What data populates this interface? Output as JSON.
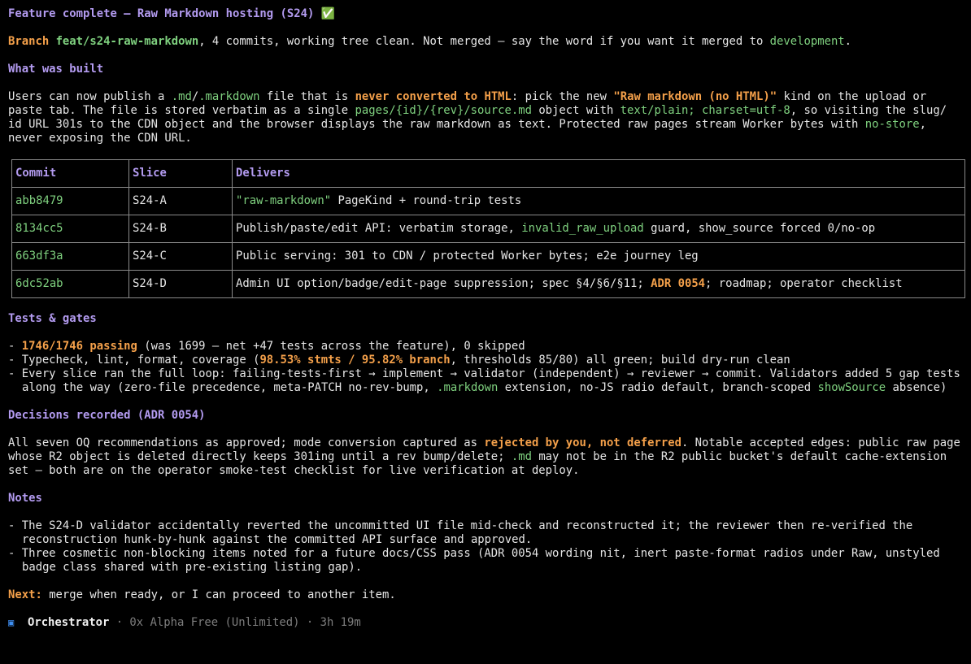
{
  "title": "Feature complete — Raw Markdown hosting (S24) ✅",
  "branch_line": {
    "label": "Branch",
    "name": "feat/s24-raw-markdown",
    "middle": ", 4 commits, working tree clean. Not merged — say the word if you want it merged to ",
    "target": "development",
    "end": "."
  },
  "built": {
    "heading": "What was built",
    "p1": "Users can now publish a ",
    "ext1": ".md",
    "slash": "/",
    "ext2": ".markdown",
    "p2": " file that is ",
    "never": "never converted to HTML",
    "p3": ": pick the new ",
    "kind": "\"Raw markdown (no HTML)\"",
    "p4": " kind on the upload or paste tab. The file is stored verbatim as a single ",
    "path": "pages/{id}/{rev}/source.md",
    "p5": " object with ",
    "ctype": "text/plain; charset=utf-8",
    "p6": ", so visiting the slug/ id URL 301s to the CDN object and the browser displays the raw markdown as text. Protected raw pages stream Worker bytes with ",
    "nostore": "no-store",
    "p7": ", never exposing the CDN URL."
  },
  "table": {
    "headers": [
      "Commit",
      "Slice",
      "Delivers"
    ],
    "rows": [
      {
        "commit": "abb8479",
        "slice": "S24-A",
        "d1": "",
        "dg": "\"raw-markdown\"",
        "d2": " PageKind + round-trip tests",
        "db": "",
        "d3": ""
      },
      {
        "commit": "8134cc5",
        "slice": "S24-B",
        "d1": "Publish/paste/edit API: verbatim storage, ",
        "dg": "invalid_raw_upload",
        "d2": " guard, show_source forced 0/no-op",
        "db": "",
        "d3": ""
      },
      {
        "commit": "663df3a",
        "slice": "S24-C",
        "d1": "Public serving: 301 to CDN / protected Worker bytes; e2e journey leg",
        "dg": "",
        "d2": "",
        "db": "",
        "d3": ""
      },
      {
        "commit": "6dc52ab",
        "slice": "S24-D",
        "d1": "Admin UI option/badge/edit-page suppression; spec §4/§6/§11; ",
        "dg": "",
        "d2": "",
        "db": "ADR 0054",
        "d3": "; roadmap; operator checklist"
      }
    ]
  },
  "tests": {
    "heading": "Tests & gates",
    "i1_bold": "1746/1746 passing",
    "i1_rest": " (was 1699 — net +47 tests across the feature), 0 skipped",
    "i2_a": "Typecheck, lint, format, coverage (",
    "i2_bold": "98.53% stmts / 95.82% branch",
    "i2_b": ", thresholds 85/80) all green; build dry-run clean",
    "i3_a": "Every slice ran the full loop: failing-tests-first → implement → validator (independent) → reviewer → commit. Validators added 5 gap tests along the way (zero-file precedence, meta-PATCH no-rev-bump, ",
    "i3_g1": ".markdown",
    "i3_b": " extension, no-JS radio default, branch-scoped ",
    "i3_g2": "showSource",
    "i3_c": " absence)"
  },
  "decisions": {
    "heading": "Decisions recorded (ADR 0054)",
    "p1": "All seven OQ recommendations as approved; mode conversion captured as ",
    "bold": "rejected by you, not deferred",
    "p2": ". Notable accepted edges: public raw page whose R2 object is deleted directly keeps 301ing until a rev bump/delete; ",
    "g": ".md",
    "p3": " may not be in the R2 public bucket's default cache-extension set — both are on the operator smoke-test checklist for live verification at deploy."
  },
  "notes": {
    "heading": "Notes",
    "n1": "The S24-D validator accidentally reverted the uncommitted UI file mid-check and reconstructed it; the reviewer then re-verified the reconstruction hunk-by-hunk against the committed API surface and approved.",
    "n2": "Three cosmetic non-blocking items noted for a future docs/CSS pass (ADR 0054 wording nit, inert paste-format radios under Raw, unstyled badge class shared with pre-existing listing gap)."
  },
  "next": {
    "label": "Next:",
    "text": " merge when ready, or I can proceed to another item."
  },
  "status": {
    "icon": "square-icon",
    "agent": "Orchestrator",
    "sep1": " · ",
    "model": "0x Alpha Free (Unlimited)",
    "sep2": " · ",
    "elapsed": "3h 19m"
  },
  "colors": {
    "heading": "#b39bf0",
    "bold_accent": "#f4a04a",
    "code": "#7fd17f",
    "status_icon": "#3e8ef0"
  }
}
